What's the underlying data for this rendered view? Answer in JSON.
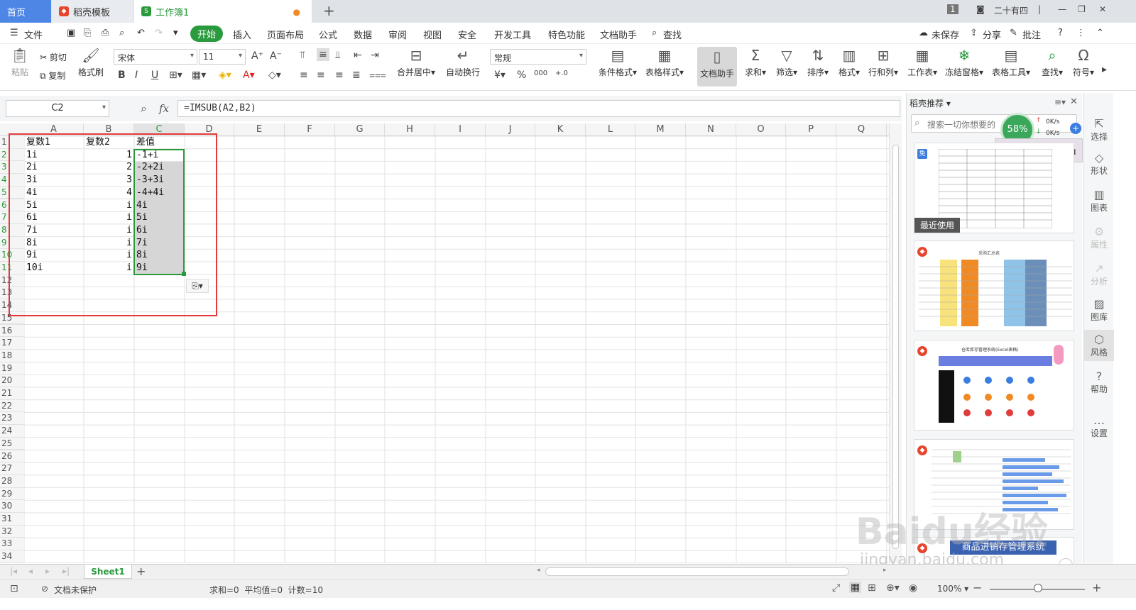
{
  "tabs": {
    "home": "首页",
    "templates": "稻壳模板",
    "workbook": "工作簿1"
  },
  "titlebar": {
    "page_num": "1",
    "user": "二十有四"
  },
  "menu": [
    "文件",
    "开始",
    "插入",
    "页面布局",
    "公式",
    "数据",
    "审阅",
    "视图",
    "安全",
    "开发工具",
    "特色功能",
    "文档助手",
    "查找"
  ],
  "menu_right": {
    "save": "未保存",
    "share": "分享",
    "comment": "批注"
  },
  "ribbon": {
    "paste": "粘贴",
    "cut": "剪切",
    "copy": "复制",
    "format_painter": "格式刷",
    "font": "宋体",
    "size": "11",
    "merge": "合并居中",
    "wrap": "自动换行",
    "numfmt": "常规",
    "cond": "条件格式",
    "table_style": "表格样式",
    "doc_helper": "文档助手",
    "sum": "求和",
    "filter": "筛选",
    "sort": "排序",
    "format": "格式",
    "rowcol": "行和列",
    "sheet": "工作表",
    "freeze": "冻结窗格",
    "table_tools": "表格工具",
    "find": "查找",
    "symbol": "符号",
    "bold": "B",
    "italic": "I",
    "underline": "U",
    "percent": "%",
    "thousand": "000",
    "decinc": "+.0",
    ".00": ".00"
  },
  "namebox": "C2",
  "fx": "fx",
  "formula": "=IMSUB(A2,B2)",
  "columns": [
    "A",
    "B",
    "C",
    "D",
    "E",
    "F",
    "G",
    "H",
    "I",
    "J",
    "K",
    "L",
    "M",
    "N",
    "O",
    "P",
    "Q"
  ],
  "rows": [
    "1",
    "2",
    "3",
    "4",
    "5",
    "6",
    "7",
    "8",
    "9",
    "10",
    "11",
    "12",
    "13",
    "14",
    "15",
    "16",
    "17",
    "18",
    "19",
    "20",
    "21",
    "22",
    "23",
    "24",
    "25",
    "26",
    "27",
    "28",
    "29",
    "30",
    "31",
    "32",
    "33",
    "34"
  ],
  "cells": {
    "A": [
      "复数1",
      "1i",
      "2i",
      "3i",
      "4i",
      "5i",
      "6i",
      "7i",
      "8i",
      "9i",
      "10i"
    ],
    "B": [
      "复数2",
      "1",
      "2",
      "3",
      "4",
      "i",
      "i",
      "i",
      "i",
      "i",
      "i"
    ],
    "C": [
      "差值",
      "-1+i",
      "-2+2i",
      "-3+3i",
      "-4+4i",
      "4i",
      "5i",
      "6i",
      "7i",
      "8i",
      "9i"
    ]
  },
  "sidebar": {
    "title": "稻壳推荐",
    "search_placeholder": "搜索一切你想要的",
    "recent": "最近使用",
    "progress": "58%",
    "up": "0K/s",
    "down": "0K/s",
    "ime": "中",
    "thumb2_title": "采购汇总表",
    "thumb3_title": "仓库库存管理系统(Excel表格)",
    "thumb5_title": "商品进销存管理系统"
  },
  "rightbar": [
    "选择",
    "形状",
    "图表",
    "属性",
    "分析",
    "图库",
    "风格",
    "帮助",
    "设置"
  ],
  "sheet": {
    "name": "Sheet1"
  },
  "status": {
    "protect": "文档未保护",
    "stats": "求和=0  平均值=0  计数=10",
    "zoom": "100%"
  },
  "watermark": {
    "brand": "Baidu经验",
    "url": "jingyan.baidu.com"
  }
}
